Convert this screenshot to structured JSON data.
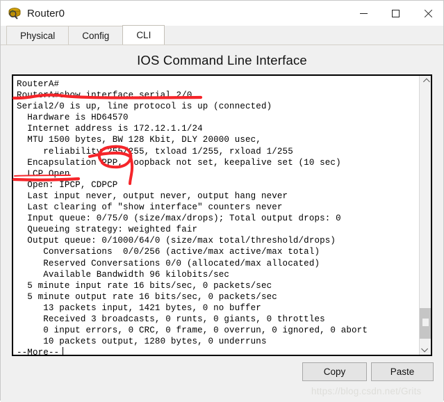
{
  "window": {
    "title": "Router0",
    "icon": "router-device-icon",
    "controls": {
      "minimize": "−",
      "maximize": "□",
      "close": "✕"
    }
  },
  "tabs": [
    {
      "label": "Physical",
      "active": false
    },
    {
      "label": "Config",
      "active": false
    },
    {
      "label": "CLI",
      "active": true
    }
  ],
  "page_title": "IOS Command Line Interface",
  "terminal": {
    "lines": [
      "RouterA#",
      "RouterA#show interface serial 2/0",
      "Serial2/0 is up, line protocol is up (connected)",
      "  Hardware is HD64570",
      "  Internet address is 172.12.1.1/24",
      "  MTU 1500 bytes, BW 128 Kbit, DLY 20000 usec,",
      "     reliability 255/255, txload 1/255, rxload 1/255",
      "  Encapsulation PPP, loopback not set, keepalive set (10 sec)",
      "  LCP Open",
      "  Open: IPCP, CDPCP",
      "  Last input never, output never, output hang never",
      "  Last clearing of \"show interface\" counters never",
      "  Input queue: 0/75/0 (size/max/drops); Total output drops: 0",
      "  Queueing strategy: weighted fair",
      "  Output queue: 0/1000/64/0 (size/max total/threshold/drops)",
      "     Conversations  0/0/256 (active/max active/max total)",
      "     Reserved Conversations 0/0 (allocated/max allocated)",
      "     Available Bandwidth 96 kilobits/sec",
      "  5 minute input rate 16 bits/sec, 0 packets/sec",
      "  5 minute output rate 16 bits/sec, 0 packets/sec",
      "     13 packets input, 1421 bytes, 0 no buffer",
      "     Received 3 broadcasts, 0 runts, 0 giants, 0 throttles",
      "     0 input errors, 0 CRC, 0 frame, 0 overrun, 0 ignored, 0 abort",
      "     10 packets output, 1280 bytes, 0 underruns",
      "--More--"
    ],
    "more_prompt": "--More--",
    "cursor_visible": true
  },
  "annotations": {
    "color": "#f5252a",
    "marks": [
      {
        "name": "underline-show-interface-command",
        "type": "underline",
        "target": "RouterA#show interface serial 2/0"
      },
      {
        "name": "underline-reliability-255",
        "type": "underline",
        "target": "reliability 255/255"
      },
      {
        "name": "circle-ppp-encapsulation",
        "type": "circle",
        "target": "PPP,"
      },
      {
        "name": "underline-lcp-open",
        "type": "underline",
        "target": "LCP Open"
      }
    ]
  },
  "footer": {
    "copy_label": "Copy",
    "paste_label": "Paste",
    "watermark": "https://blog.csdn.net/Grits"
  },
  "scrollbar": {
    "up_arrow": "chevron-up",
    "down_arrow": "chevron-down",
    "position": "near-bottom"
  }
}
